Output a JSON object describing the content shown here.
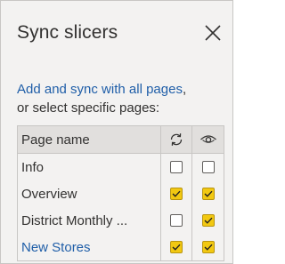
{
  "header": {
    "title": "Sync slicers",
    "close_icon": "close-icon"
  },
  "description": {
    "link_text": "Add and sync with all pages",
    "suffix": ",",
    "line2": "or select specific pages:"
  },
  "table": {
    "column_name": "Page name",
    "sync_icon": "sync-icon",
    "visible_icon": "eye-icon",
    "rows": [
      {
        "name": "Info",
        "sync": false,
        "visible": false,
        "active": false
      },
      {
        "name": "Overview",
        "sync": true,
        "visible": true,
        "active": false
      },
      {
        "name": "District Monthly ...",
        "sync": false,
        "visible": true,
        "active": false
      },
      {
        "name": "New Stores",
        "sync": true,
        "visible": true,
        "active": true
      }
    ]
  },
  "colors": {
    "accent_checkbox": "#f2c811",
    "link": "#1f5ea8",
    "pane_bg": "#f3f2f1"
  }
}
